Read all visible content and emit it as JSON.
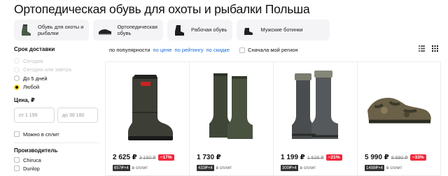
{
  "title": "Ортопедическая обувь для охоты и рыбалки Польша",
  "categories": [
    {
      "label": "Обувь для охоты и\nрыбалки",
      "icon": "boot-thumb-icon"
    },
    {
      "label": "Ортопедическая\nобувь",
      "icon": "shoe-thumb-icon"
    },
    {
      "label": "Рабочая обувь",
      "icon": "work-boot-thumb-icon"
    },
    {
      "label": "Мужские ботинки",
      "icon": "men-boot-thumb-icon"
    }
  ],
  "sidebar": {
    "delivery_title": "Срок доставки",
    "delivery_options": [
      {
        "label": "Сегодня",
        "state": "disabled"
      },
      {
        "label": "Сегодня или завтра",
        "state": "disabled"
      },
      {
        "label": "До 5 дней",
        "state": "normal"
      },
      {
        "label": "Любой",
        "state": "checked"
      }
    ],
    "price_title": "Цена, ₽",
    "price_from_placeholder": "от 1 199",
    "price_to_placeholder": "до 38 180",
    "split_label": "Можно в сплит",
    "maker_title": "Производитель",
    "makers": [
      "Chiruca",
      "Dunlop"
    ]
  },
  "sort": {
    "popular": "по популярности",
    "price": "по цене",
    "rating": "по рейтингу",
    "discount": "по скидке",
    "region": "Сначала мой регион"
  },
  "products": [
    {
      "price": "2 625 ₽",
      "old_price": "3 150 ₽",
      "discount": "−17%",
      "split_amount": "657₽×4",
      "split_text": "в сплит"
    },
    {
      "price": "1 730 ₽",
      "old_price": "",
      "discount": "",
      "split_amount": "433₽×4",
      "split_text": "в сплит"
    },
    {
      "price": "1 199 ₽",
      "old_price": "1 526 ₽",
      "discount": "−21%",
      "split_amount": "300₽×4",
      "split_text": "в сплит"
    },
    {
      "price": "5 990 ₽",
      "old_price": "8 990 ₽",
      "discount": "−33%",
      "split_amount": "1498₽×4",
      "split_text": "в сплит"
    }
  ]
}
